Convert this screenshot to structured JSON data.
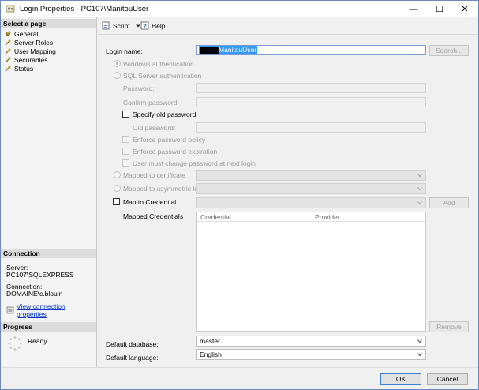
{
  "window": {
    "title": "Login Properties - PC107\\ManitouUser",
    "controls": {
      "minimize": "—",
      "maximize": "☐",
      "close": "✕"
    }
  },
  "left_pane": {
    "select_page_header": "Select a page",
    "pages": [
      {
        "label": "General",
        "icon": "wrench-icon"
      },
      {
        "label": "Server Roles",
        "icon": "wrench-icon"
      },
      {
        "label": "User Mapping",
        "icon": "wrench-icon"
      },
      {
        "label": "Securables",
        "icon": "wrench-icon"
      },
      {
        "label": "Status",
        "icon": "wrench-icon"
      }
    ],
    "connection_header": "Connection",
    "server_label": "Server:",
    "server_value": "PC107\\SQLEXPRESS",
    "connection_label": "Connection:",
    "connection_value": "DOMAINE\\c.blouin",
    "view_connection_link": "View connection properties",
    "progress_header": "Progress",
    "progress_status": "Ready"
  },
  "toolbar": {
    "script_label": "Script",
    "help_label": "Help"
  },
  "general": {
    "login_name_label": "Login name:",
    "login_name_value": "ManitouUser",
    "search_button": "Search...",
    "windows_auth": "Windows authentication",
    "sql_auth": "SQL Server authentication",
    "password_label": "Password:",
    "confirm_password_label": "Confirm password:",
    "specify_old_password": "Specify old password",
    "old_password_label": "Old password:",
    "enforce_policy": "Enforce password policy",
    "enforce_expiration": "Enforce password expiration",
    "must_change": "User must change password at next login",
    "mapped_cert": "Mapped to certificate",
    "mapped_asym": "Mapped to asymmetric key",
    "map_credential": "Map to Credential",
    "add_button": "Add",
    "mapped_credentials_label": "Mapped Credentials",
    "grid_columns": [
      "Credential",
      "Provider"
    ],
    "remove_button": "Remove",
    "default_database_label": "Default database:",
    "default_database_value": "master",
    "default_language_label": "Default language:",
    "default_language_value": "English"
  },
  "footer": {
    "ok_button": "OK",
    "cancel_button": "Cancel"
  },
  "colors": {
    "selection": "#3399ff",
    "link": "#0033cc",
    "default_button_border": "#3c7fd6"
  }
}
